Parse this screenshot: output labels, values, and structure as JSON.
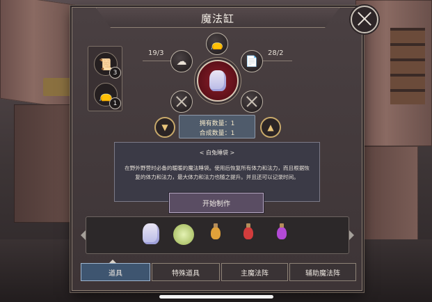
{
  "dialog": {
    "title": "魔法缸"
  },
  "side_slots": [
    {
      "icon": "scroll-bag-icon",
      "count": "3"
    },
    {
      "icon": "pouch-icon",
      "count": "1"
    }
  ],
  "recipe": {
    "left_ratio": "19/3",
    "right_ratio": "28/2",
    "owned_label": "拥有数量：1",
    "craft_label": "合成数量：1"
  },
  "description": {
    "name": "< 白兔睡袋 >",
    "text": "在野外野营时必备的暖暖的魔法睡袋。使用后恢复所有体力和法力，而且根据恢复的体力和法力，最大体力和法力也随之提升。并且还可以记录时间。"
  },
  "craft_button": "开始制作",
  "items": [
    {
      "icon": "white-rabbit-sleeping-bag-icon"
    },
    {
      "icon": "green-herb-icon"
    },
    {
      "icon": "orange-potion-icon",
      "color": "#e0a13a"
    },
    {
      "icon": "red-potion-icon",
      "color": "#d23c3c"
    },
    {
      "icon": "purple-potion-icon",
      "color": "#b34ad6"
    }
  ],
  "tabs": [
    {
      "label": "道具",
      "active": true
    },
    {
      "label": "特殊道具",
      "active": false
    },
    {
      "label": "主魔法阵",
      "active": false
    },
    {
      "label": "辅助魔法阵",
      "active": false
    }
  ]
}
